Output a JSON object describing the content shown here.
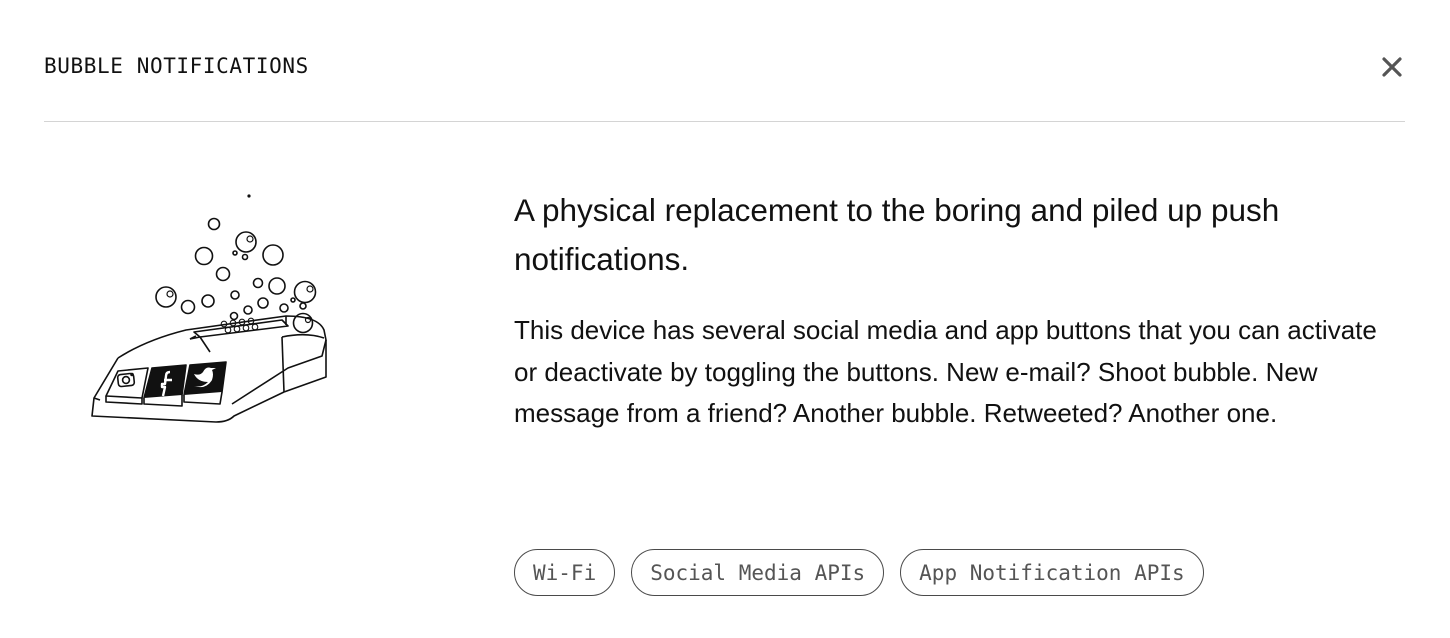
{
  "header": {
    "title": "BUBBLE NOTIFICATIONS",
    "close_icon": "close-icon"
  },
  "illustration": {
    "icon_name": "bubble-device-illustration",
    "buttons": [
      "instagram-icon",
      "facebook-icon",
      "twitter-icon"
    ]
  },
  "content": {
    "headline": "A physical replacement to the boring and piled up push notifications.",
    "description": "This device has several social media and app buttons that you can activate or deactivate by toggling the buttons. New e-mail? Shoot bubble. New message from a friend? Another bubble. Retweeted? Another one."
  },
  "tags": [
    {
      "label": "Wi-Fi"
    },
    {
      "label": "Social Media APIs"
    },
    {
      "label": "App Notification APIs"
    }
  ],
  "colors": {
    "text": "#111111",
    "muted": "#555555",
    "divider": "#d4d4d4",
    "background": "#ffffff"
  }
}
